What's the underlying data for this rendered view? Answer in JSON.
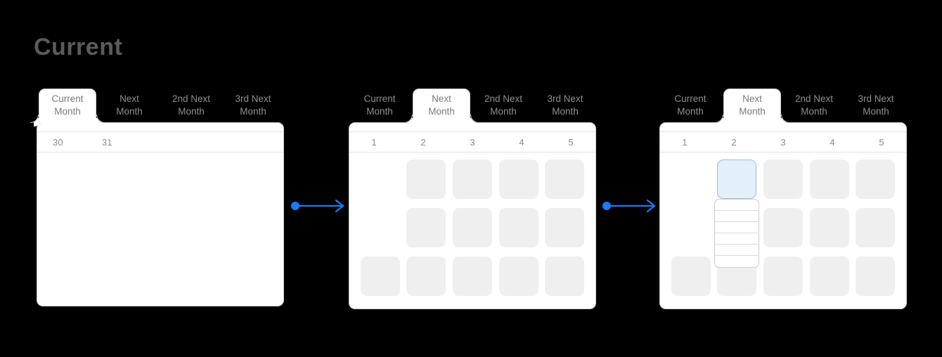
{
  "page": {
    "title": "Current",
    "background_color": "#000000"
  },
  "colors": {
    "accent": "#1a7cf5",
    "card_border": "#cfcfcf",
    "cell_fill": "#efefef",
    "selected_cell_fill": "#e3effb",
    "selected_cell_border": "#a9b8c6",
    "title_text": "#5b5b5b",
    "tab_text": "#8f8f8f",
    "day_number_text": "#8a8a8a"
  },
  "tabs": [
    {
      "line1": "Current",
      "line2": "Month"
    },
    {
      "line1": "Next",
      "line2": "Month"
    },
    {
      "line1": "2nd Next",
      "line2": "Month"
    },
    {
      "line1": "3rd Next",
      "line2": "Month"
    }
  ],
  "cards": [
    {
      "id": "current-month-card",
      "active_tab_index": 0,
      "day_numbers": [
        "30",
        "31",
        "",
        "",
        ""
      ],
      "day_number_align": "left",
      "rows": [],
      "dropdown": null
    },
    {
      "id": "next-month-card",
      "active_tab_index": 1,
      "day_numbers": [
        "1",
        "2",
        "3",
        "4",
        "5"
      ],
      "day_number_align": "center",
      "rows": [
        [
          "empty",
          "cell",
          "cell",
          "cell",
          "cell"
        ],
        [
          "empty",
          "cell",
          "cell",
          "cell",
          "cell"
        ],
        [
          "cell",
          "cell",
          "cell",
          "cell",
          "cell"
        ]
      ],
      "dropdown": null
    },
    {
      "id": "next-month-expanded-card",
      "active_tab_index": 1,
      "day_numbers": [
        "1",
        "2",
        "3",
        "4",
        "5"
      ],
      "day_number_align": "center",
      "rows": [
        [
          "empty",
          "selected",
          "cell",
          "cell",
          "cell"
        ],
        [
          "empty",
          "empty",
          "cell",
          "cell",
          "cell"
        ],
        [
          "cell",
          "cell",
          "cell",
          "cell",
          "cell"
        ]
      ],
      "dropdown": {
        "row_count": 6,
        "column_index": 1
      }
    }
  ],
  "connectors": [
    {
      "id": "arrow-card1-to-card2",
      "direction": "right"
    },
    {
      "id": "arrow-card2-to-card3",
      "direction": "right"
    }
  ]
}
